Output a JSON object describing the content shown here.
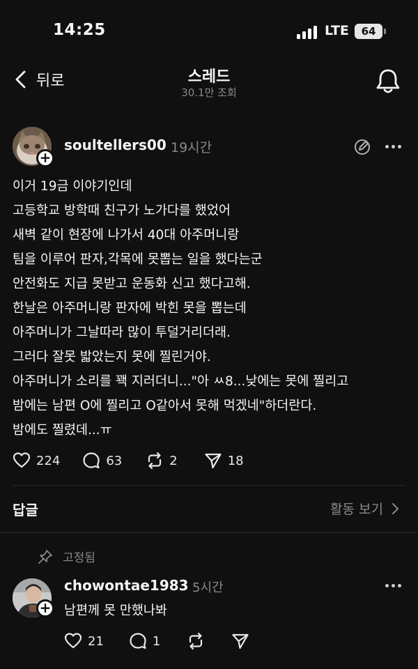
{
  "status_bar": {
    "time": "14:25",
    "network": "LTE",
    "battery": "64"
  },
  "header": {
    "back_label": "뒤로",
    "title": "스레드",
    "subtitle": "30.1만 조회"
  },
  "post": {
    "author": "soultellers00",
    "time": "19시간",
    "body_lines": [
      "이거 19금 이야기인데",
      "고등학교 방학때 친구가 노가다를 했었어",
      "새벽 같이 현장에 나가서 40대 아주머니랑",
      "팀을 이루어 판자,각목에 못뽑는 일을 했다는군",
      "안전화도 지급 못받고 운동화 신고 했다고해.",
      "한날은 아주머니랑 판자에 박힌 못을 뽑는데",
      "아주머니가 그날따라 많이 투덜거리더래.",
      "그러다 잘못 밟았는지 못에 찔린거야.",
      "아주머니가 소리를 꽥 지러더니...\"아 ㅆ8...낮에는 못에 찔리고",
      "밤에는 남편 O에 찔리고 O같아서 못해 먹겠네\"하더란다.",
      "밤에도 찔렸데...ㅠ"
    ],
    "likes": "224",
    "comments": "63",
    "reposts": "2",
    "shares": "18"
  },
  "replies_section": {
    "label": "답글",
    "activity_label": "활동 보기"
  },
  "comment": {
    "pinned_label": "고정됨",
    "author": "chowontae1983",
    "time": "5시간",
    "text": "남편께 못 만했나봐",
    "likes": "21",
    "comments": "1"
  },
  "colors": {
    "background": "#101010",
    "text": "#f3f5f7",
    "muted": "#8a8a8a",
    "divider": "#2a2a2a"
  },
  "icons": {
    "back": "chevron-left-icon",
    "notifications": "bell-icon",
    "edit": "edit-icon",
    "more": "more-icon",
    "like": "heart-icon",
    "comment": "comment-icon",
    "repost": "repost-icon",
    "share": "send-icon",
    "pin": "pin-icon"
  }
}
